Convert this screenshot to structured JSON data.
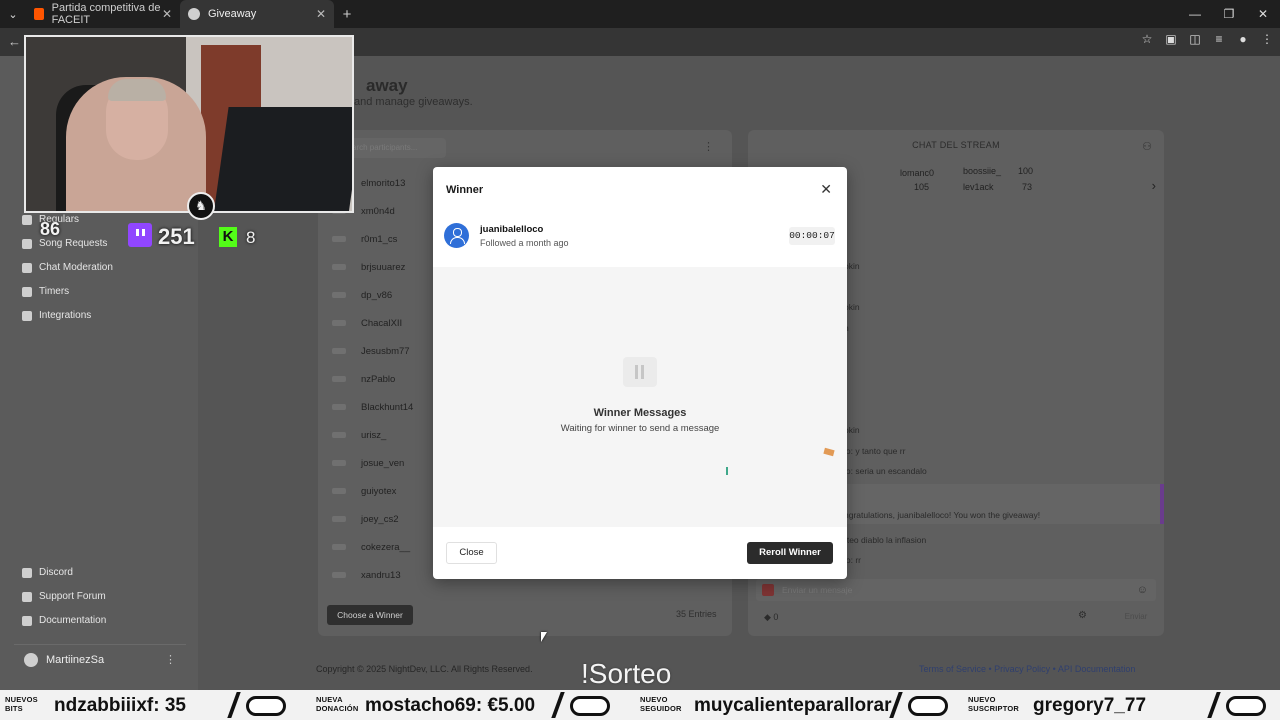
{
  "browser": {
    "tabs": [
      {
        "title": "Partida competitiva de FACEIT",
        "active": false
      },
      {
        "title": "Giveaway",
        "active": true
      }
    ]
  },
  "sidebar": {
    "items": [
      "Regulars",
      "Song Requests",
      "Chat Moderation",
      "Timers",
      "Integrations"
    ],
    "bottom_items": [
      "Discord",
      "Support Forum",
      "Documentation"
    ],
    "user": "MartiinezSa"
  },
  "page": {
    "title": "away",
    "subtitle": "and manage giveaways."
  },
  "entries": {
    "search_placeholder": "arch participants...",
    "names": [
      "elmorito13",
      "xm0n4d",
      "r0m1_cs",
      "brjsuuarez",
      "dp_v86",
      "ChacalXII",
      "Jesusbm77",
      "nzPablo",
      "Blackhunt14",
      "urisz_",
      "josue_ven",
      "guiyotex",
      "joey_cs2",
      "cokezera__",
      "xandru13"
    ],
    "choose_button": "Choose a Winner",
    "count": "35 Entries"
  },
  "chat": {
    "title": "CHAT DEL STREAM",
    "top": [
      {
        "name": "lomanc0",
        "value": "105"
      },
      {
        "name": "boossiie_",
        "value": "100"
      },
      {
        "name": "lev1ack",
        "value": "73"
      }
    ],
    "lines": [
      "okin",
      "okin",
      "n",
      "okin",
      "io: y tanto que rr",
      "io: seria un escandalo",
      "ngratulations, juanibalelloco! You won the giveaway!",
      "rteo diablo la inflasion",
      "io: rr"
    ],
    "input_placeholder": "Enviar un mensaje",
    "points": "0",
    "send_label": "Enviar"
  },
  "footer": {
    "copyright": "Copyright © 2025 NightDev, LLC. All Rights Reserved.",
    "links": "Terms of Service • Privacy Policy • API Documentation"
  },
  "overlay": {
    "stat1": "86",
    "twitch_viewers": "251",
    "kick_viewers": "8",
    "scene_text": "!Sorteo"
  },
  "modal": {
    "title": "Winner",
    "winner_name": "juanibalelloco",
    "winner_follow": "Followed a month ago",
    "timer": "00:00:07",
    "messages_title": "Winner Messages",
    "messages_sub": "Waiting for winner to send a message",
    "close_button": "Close",
    "reroll_button": "Reroll Winner"
  },
  "ticker": {
    "items": [
      {
        "label1": "NUEVOS",
        "label2": "BITS",
        "text": "ndzabbiiixf: 35"
      },
      {
        "label1": "NUEVA",
        "label2": "DONACIÓN",
        "text": "mostacho69: €5.00"
      },
      {
        "label1": "NUEVO",
        "label2": "SEGUIDOR",
        "text": "muycalienteparallorar"
      },
      {
        "label1": "NUEVO",
        "label2": "SUSCRIPTOR",
        "text": "gregory7_77"
      }
    ]
  },
  "icons": {
    "close": "close-icon",
    "user": "user-icon",
    "pause": "pause-icon"
  }
}
